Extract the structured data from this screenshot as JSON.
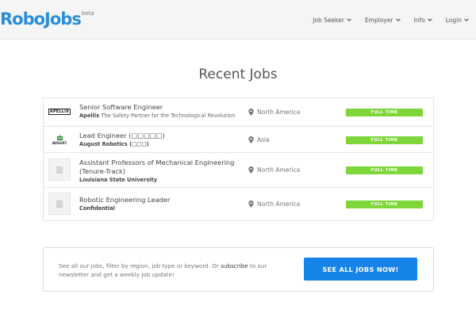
{
  "header": {
    "logo_text": "RoboJobs",
    "logo_beta": "beta",
    "nav": [
      {
        "label": "Job Seeker",
        "icon": "chevron-down-icon"
      },
      {
        "label": "Employer",
        "icon": "chevron-down-icon"
      },
      {
        "label": "Info",
        "icon": "chevron-down-icon"
      },
      {
        "label": "Login",
        "icon": "chevron-down-icon"
      }
    ]
  },
  "main": {
    "title": "Recent Jobs",
    "jobs": [
      {
        "title": "Senior Software Engineer",
        "company": "Apellix",
        "tagline": "The Safety Partner for the Technological Revolution",
        "location": "North America",
        "type": "FULL TIME",
        "logo_text": "APELLIX"
      },
      {
        "title": "Lead Engineer (□□□□□)",
        "company": "August Robotics (□□□)",
        "tagline": "",
        "location": "Asia",
        "type": "FULL TIME",
        "logo_text": "AUGUST"
      },
      {
        "title": "Assistant Professors of Mechanical Engineering (Tenure-Track)",
        "company": "Louisiana State University",
        "tagline": "",
        "location": "North America",
        "type": "FULL TIME",
        "logo_text": ""
      },
      {
        "title": "Robotic Engineering Leader",
        "company": "Confidential",
        "tagline": "",
        "location": "North America",
        "type": "FULL TIME",
        "logo_text": ""
      }
    ]
  },
  "cta": {
    "text_before": "See all our jobs, filter by region, job type or keyword. Or",
    "link_text": "subscribe",
    "text_after": "to our newsletter and get a weekly job update!",
    "button_label": "SEE ALL JOBS NOW!"
  },
  "colors": {
    "brand": "#2a8fd8",
    "badge": "#7fd63a",
    "button": "#1683e8"
  }
}
